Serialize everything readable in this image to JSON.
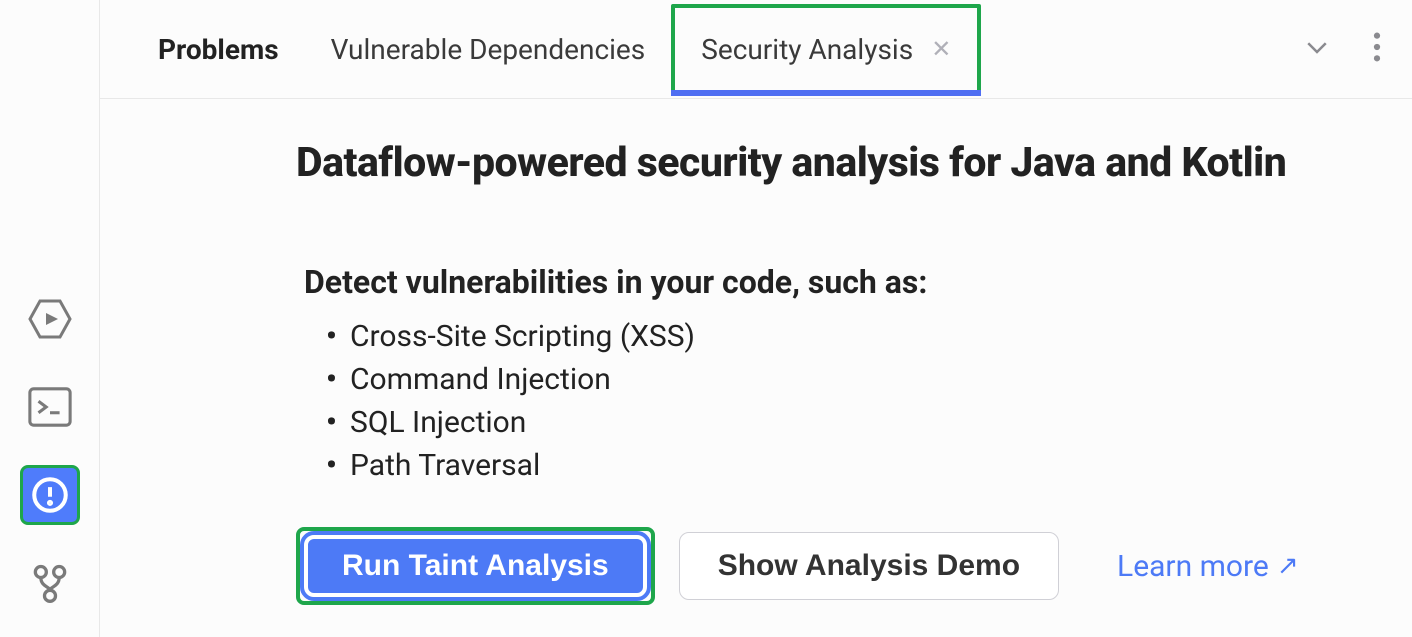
{
  "sidebar": {
    "icons": [
      "services-icon",
      "terminal-icon",
      "problems-icon",
      "version-control-icon"
    ],
    "active": "problems-icon"
  },
  "tabs": {
    "items": [
      {
        "label": "Problems",
        "emphasized": true
      },
      {
        "label": "Vulnerable Dependencies"
      },
      {
        "label": "Security Analysis",
        "highlighted": true,
        "closable": true,
        "active": true
      }
    ]
  },
  "content": {
    "title": "Dataflow-powered security analysis for Java and Kotlin",
    "subtitle": "Detect vulnerabilities in your code, such as:",
    "vulnerabilities": [
      "Cross-Site Scripting (XSS)",
      "Command Injection",
      "SQL Injection",
      "Path Traversal"
    ],
    "primaryButton": "Run Taint Analysis",
    "secondaryButton": "Show Analysis Demo",
    "link": "Learn more"
  }
}
